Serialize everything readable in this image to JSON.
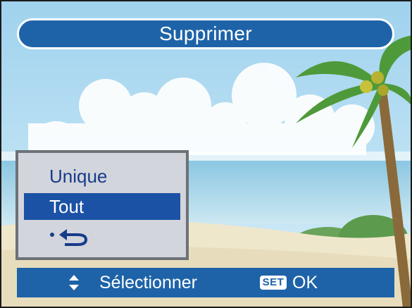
{
  "screen": {
    "title": "Supprimer"
  },
  "menu": {
    "items": [
      {
        "label": "Unique",
        "selected": false
      },
      {
        "label": "Tout",
        "selected": true
      },
      {
        "icon": "back-arrow-icon",
        "label": ""
      }
    ]
  },
  "status_bar": {
    "navigate_icon": "up-down-arrows-icon",
    "navigate_label": "Sélectionner",
    "confirm_icon": "set-key-icon",
    "confirm_icon_text": "SET",
    "confirm_label": "OK"
  },
  "colors": {
    "accent": "#1e63a8",
    "selection": "#1b52a5",
    "menu_text": "#173c8a",
    "menu_bg": "#d3d5dc"
  }
}
